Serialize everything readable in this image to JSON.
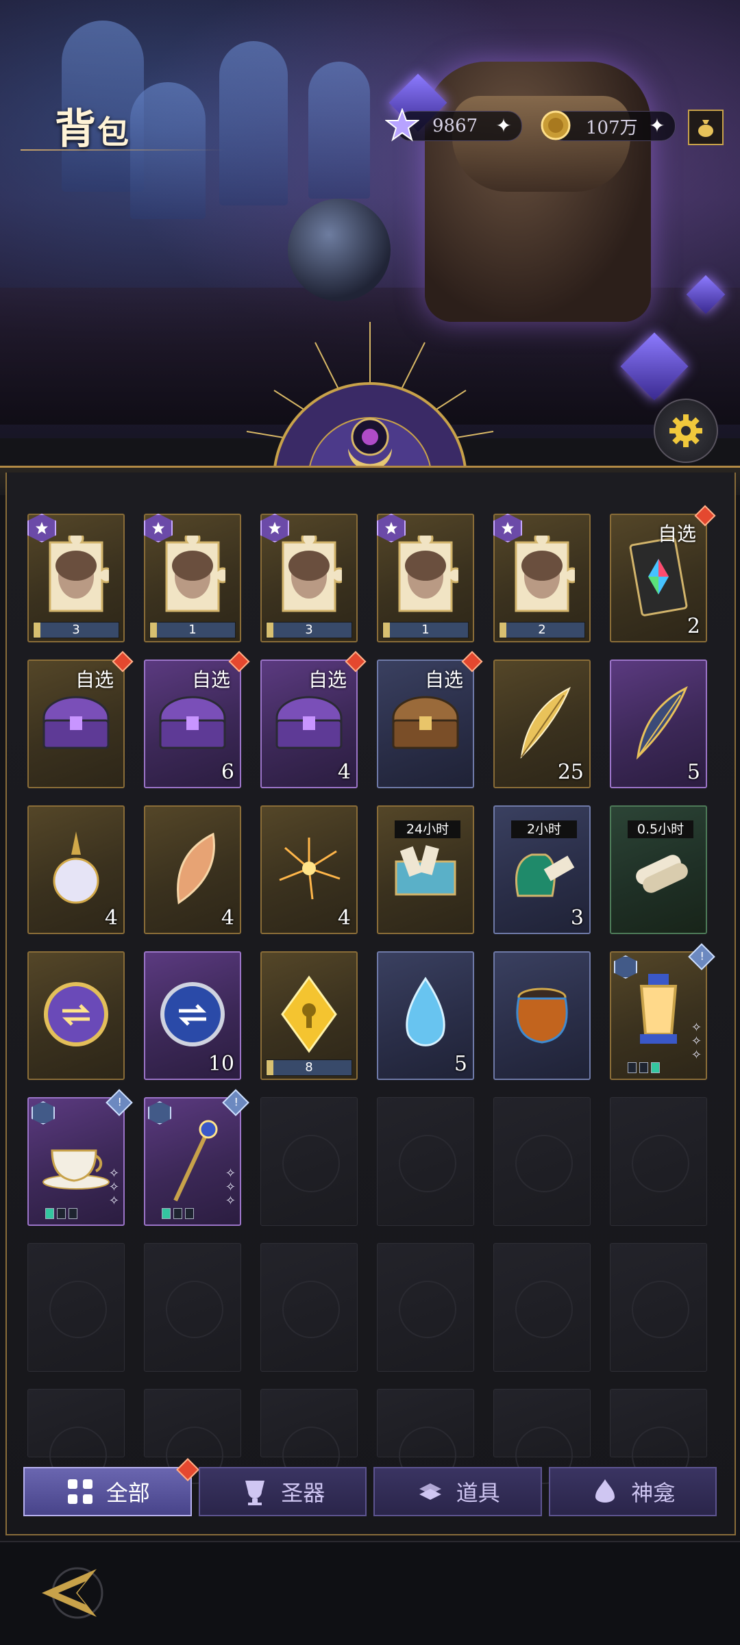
{
  "header": {
    "title_main": "背",
    "title_small": "包",
    "currency_star": "9867",
    "currency_coin": "107万",
    "icons": {
      "star": "star-crystal-icon",
      "coin": "gold-coin-icon",
      "bag": "gold-bag-icon",
      "settings": "gear-icon"
    }
  },
  "grid": [
    {
      "type": "puzzle",
      "frame": "gold",
      "progress": "3"
    },
    {
      "type": "puzzle",
      "frame": "gold",
      "progress": "1"
    },
    {
      "type": "puzzle",
      "frame": "gold",
      "progress": "3"
    },
    {
      "type": "puzzle",
      "frame": "gold",
      "progress": "1"
    },
    {
      "type": "puzzle",
      "frame": "gold",
      "progress": "2"
    },
    {
      "type": "card",
      "frame": "gold",
      "tag": "自选",
      "count": "2"
    },
    {
      "type": "chest",
      "frame": "gold",
      "tag": "自选",
      "count": ""
    },
    {
      "type": "chest",
      "frame": "purple",
      "tag": "自选",
      "count": "6"
    },
    {
      "type": "chest",
      "frame": "purple",
      "tag": "自选",
      "count": "4"
    },
    {
      "type": "chest-wood",
      "frame": "blue",
      "tag": "自选",
      "count": ""
    },
    {
      "type": "feather",
      "frame": "gold",
      "count": "25"
    },
    {
      "type": "feather-dark",
      "frame": "purple",
      "count": "5"
    },
    {
      "type": "vial",
      "frame": "gold",
      "count": "4"
    },
    {
      "type": "shell",
      "frame": "gold",
      "count": "4"
    },
    {
      "type": "firework",
      "frame": "gold",
      "count": "4"
    },
    {
      "type": "scroll-chest",
      "frame": "gold",
      "timer": "24小时",
      "count": ""
    },
    {
      "type": "scroll-bag",
      "frame": "blue",
      "timer": "2小时",
      "count": "3"
    },
    {
      "type": "scroll",
      "frame": "green",
      "timer": "0.5小时",
      "count": ""
    },
    {
      "type": "medal",
      "frame": "gold",
      "count": ""
    },
    {
      "type": "medal-blue",
      "frame": "purple",
      "count": "10"
    },
    {
      "type": "crystal",
      "frame": "gold",
      "progress": "8"
    },
    {
      "type": "droplet",
      "frame": "blue",
      "count": "5"
    },
    {
      "type": "pot",
      "frame": "blue",
      "count": ""
    },
    {
      "type": "lantern",
      "frame": "gold",
      "info": "!",
      "pips": [
        false,
        false,
        true
      ]
    },
    {
      "type": "teacup",
      "frame": "purple",
      "info": "!",
      "pips": [
        true,
        false,
        false
      ]
    },
    {
      "type": "staff",
      "frame": "purple",
      "info": "!",
      "pips": [
        true,
        false,
        false
      ]
    }
  ],
  "tabs": [
    {
      "label": "全部",
      "icon": "all-grid-icon",
      "active": true
    },
    {
      "label": "圣器",
      "icon": "chalice-icon",
      "active": false
    },
    {
      "label": "道具",
      "icon": "items-stack-icon",
      "active": false
    },
    {
      "label": "神龛",
      "icon": "shrine-icon",
      "active": false
    }
  ],
  "colors": {
    "accent_gold": "#c8a24a",
    "tab_active": "#6a66b0",
    "red_dot": "#e4482f"
  }
}
